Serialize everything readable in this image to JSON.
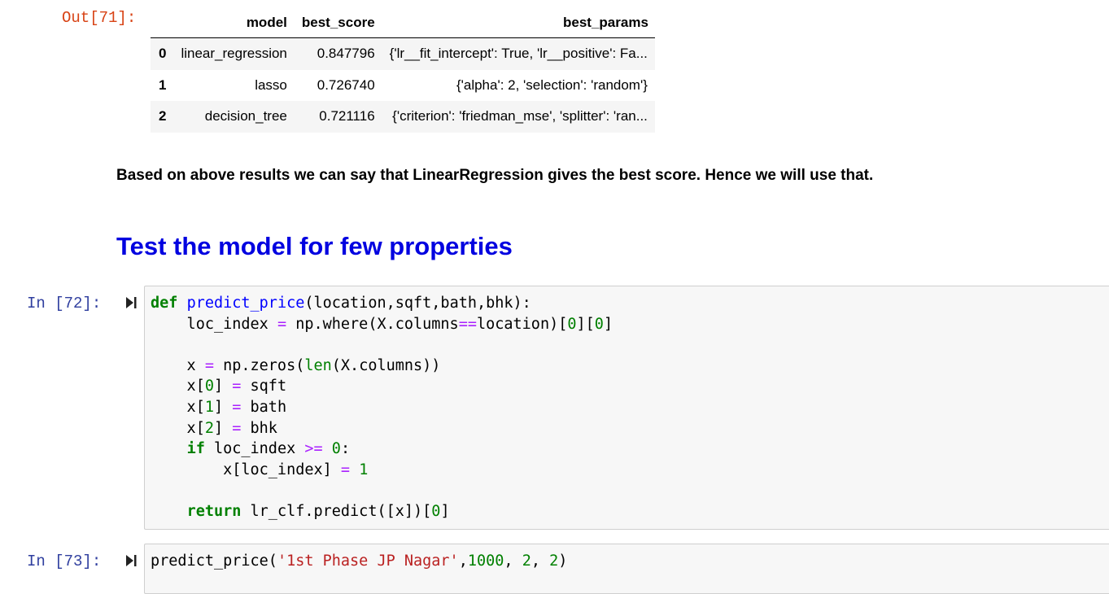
{
  "out71": {
    "prompt": "Out[71]:",
    "columns": [
      "model",
      "best_score",
      "best_params"
    ],
    "rows": [
      {
        "index": "0",
        "model": "linear_regression",
        "best_score": "0.847796",
        "best_params": "{'lr__fit_intercept': True, 'lr__positive': Fa..."
      },
      {
        "index": "1",
        "model": "lasso",
        "best_score": "0.726740",
        "best_params": "{'alpha': 2, 'selection': 'random'}"
      },
      {
        "index": "2",
        "model": "decision_tree",
        "best_score": "0.721116",
        "best_params": "{'criterion': 'friedman_mse', 'splitter': 'ran..."
      }
    ]
  },
  "markdown": {
    "summary": "Based on above results we can say that LinearRegression gives the best score. Hence we will use that.",
    "heading": "Test the model for few properties"
  },
  "cell72": {
    "prompt": "In [72]:",
    "code_lines": [
      "def predict_price(location,sqft,bath,bhk):",
      "    loc_index = np.where(X.columns==location)[0][0]",
      "",
      "    x = np.zeros(len(X.columns))",
      "    x[0] = sqft",
      "    x[1] = bath",
      "    x[2] = bhk",
      "    if loc_index >= 0:",
      "        x[loc_index] = 1",
      "",
      "    return lr_clf.predict([x])[0]"
    ]
  },
  "cell73": {
    "prompt": "In [73]:",
    "code_lines": [
      "predict_price('1st Phase JP Nagar',1000, 2, 2)"
    ]
  },
  "icons": {
    "run": "run-cell-icon"
  },
  "colors": {
    "out_prompt": "#d84315",
    "in_prompt": "#303f9f",
    "heading": "#0000e0",
    "keyword": "#008000",
    "function": "#0000ff",
    "operator": "#aa22ff",
    "string": "#ba2121"
  }
}
